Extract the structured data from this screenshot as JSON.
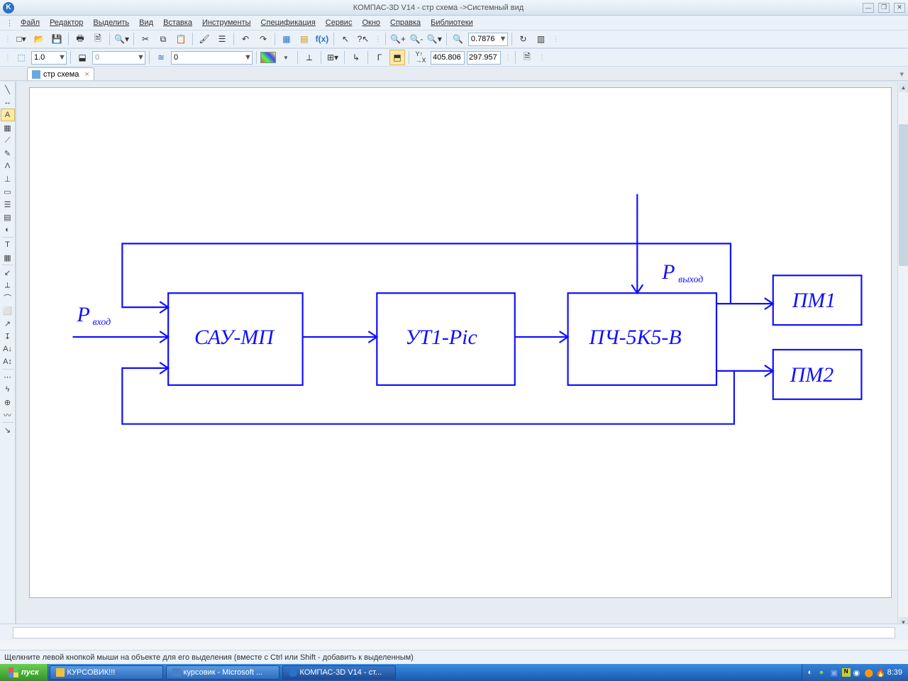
{
  "title": "КОМПАС-3D V14 - стр схема ->Системный вид",
  "menu": [
    "Файл",
    "Редактор",
    "Выделить",
    "Вид",
    "Вставка",
    "Инструменты",
    "Спецификация",
    "Сервис",
    "Окно",
    "Справка",
    "Библиотеки"
  ],
  "toolbar1": {
    "zoom_value": "0.7876"
  },
  "toolbar2": {
    "scale_value": "1.0",
    "layer_value": "0",
    "style_value": "0",
    "coord_x": "405.806",
    "coord_y": "297.957"
  },
  "tab": {
    "label": "стр схема"
  },
  "statusbar": "Щелкните левой кнопкой мыши на объекте для его выделения (вместе с Ctrl или Shift - добавить к выделенным)",
  "taskbar": {
    "start": "пуск",
    "items": [
      "КУРСОВИК!!!",
      "курсовик - Microsoft ...",
      "КОМПАС-3D V14 - ст..."
    ],
    "clock": "8:39"
  },
  "diagram": {
    "p_in": "P",
    "p_in_sub": "вход",
    "p_out": "P",
    "p_out_sub": "выход",
    "block1": "САУ-МП",
    "block2": "УТ1-Pic",
    "block3": "ПЧ-5К5-В",
    "block4": "ПМ1",
    "block5": "ПМ2"
  }
}
